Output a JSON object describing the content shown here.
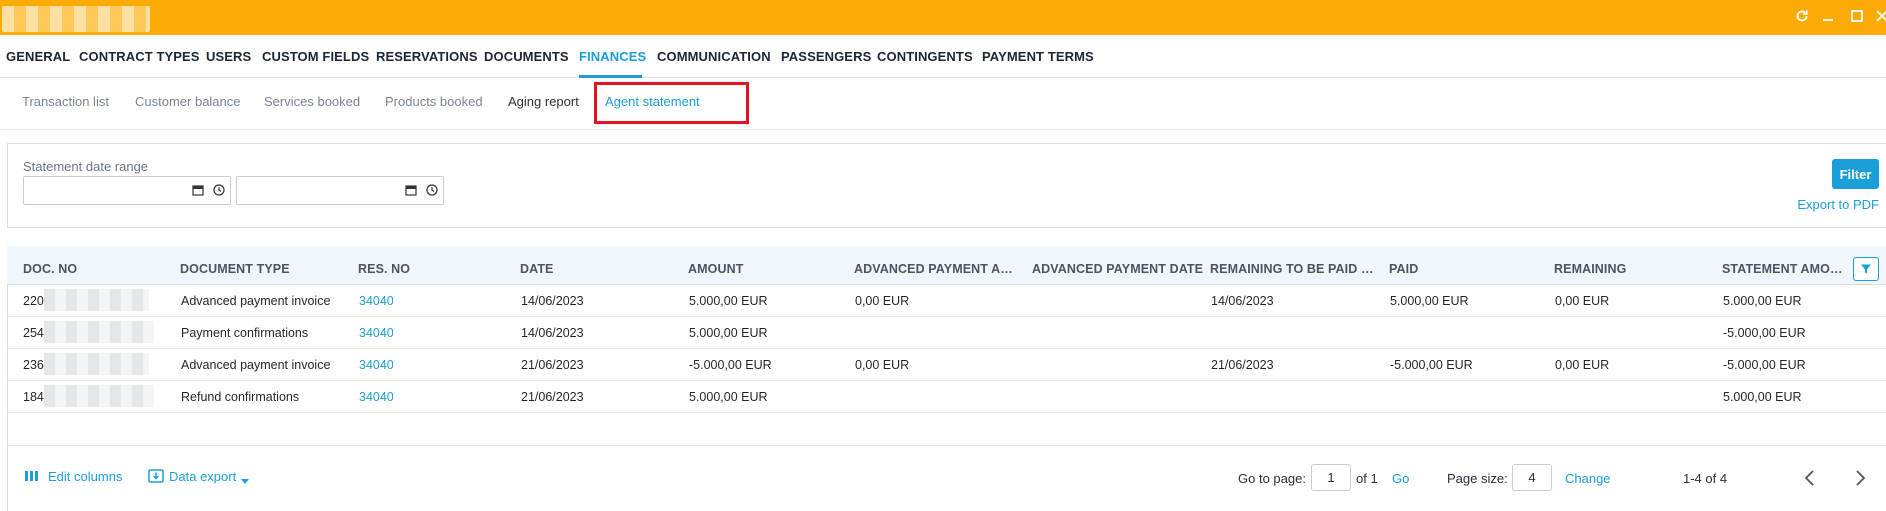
{
  "window": {
    "controls": [
      "refresh-icon",
      "minimize-icon",
      "maximize-icon",
      "close-icon"
    ]
  },
  "main_nav": {
    "tabs": [
      {
        "label": "GENERAL"
      },
      {
        "label": "CONTRACT TYPES"
      },
      {
        "label": "USERS"
      },
      {
        "label": "CUSTOM FIELDS"
      },
      {
        "label": "RESERVATIONS"
      },
      {
        "label": "DOCUMENTS"
      },
      {
        "label": "FINANCES",
        "active": true
      },
      {
        "label": "COMMUNICATION"
      },
      {
        "label": "PASSENGERS"
      },
      {
        "label": "CONTINGENTS"
      },
      {
        "label": "PAYMENT TERMS"
      }
    ]
  },
  "sub_nav": {
    "tabs": [
      {
        "label": "Transaction list"
      },
      {
        "label": "Customer balance"
      },
      {
        "label": "Services booked"
      },
      {
        "label": "Products booked"
      },
      {
        "label": "Aging report"
      },
      {
        "label": "Agent statement",
        "active": true
      }
    ]
  },
  "filter": {
    "label": "Statement date range",
    "from_value": "",
    "to_value": "",
    "filter_button": "Filter",
    "export_link": "Export to PDF"
  },
  "table": {
    "headers": [
      "DOC. NO",
      "DOCUMENT TYPE",
      "RES. NO",
      "DATE",
      "AMOUNT",
      "ADVANCED PAYMENT AM...",
      "ADVANCED PAYMENT DATE",
      "REMAINING TO BE PAID TI...",
      "PAID",
      "REMAINING",
      "STATEMENT AMOU..."
    ],
    "rows": [
      {
        "doc_no": "220",
        "doc_type": "Advanced payment invoice",
        "res_no": "34040",
        "date": "14/06/2023",
        "amount": "5.000,00 EUR",
        "adv_amount": "0,00 EUR",
        "adv_date": "",
        "remaining_date": "14/06/2023",
        "paid": "5.000,00 EUR",
        "remaining": "0,00 EUR",
        "statement_amount": "5.000,00 EUR"
      },
      {
        "doc_no": "254",
        "doc_type": "Payment confirmations",
        "res_no": "34040",
        "date": "14/06/2023",
        "amount": "5.000,00 EUR",
        "adv_amount": "",
        "adv_date": "",
        "remaining_date": "",
        "paid": "",
        "remaining": "",
        "statement_amount": "-5.000,00 EUR"
      },
      {
        "doc_no": "236",
        "doc_type": "Advanced payment invoice",
        "res_no": "34040",
        "date": "21/06/2023",
        "amount": "-5.000,00 EUR",
        "adv_amount": "0,00 EUR",
        "adv_date": "",
        "remaining_date": "21/06/2023",
        "paid": "-5.000,00 EUR",
        "remaining": "0,00 EUR",
        "statement_amount": "-5.000,00 EUR"
      },
      {
        "doc_no": "184",
        "doc_type": "Refund confirmations",
        "res_no": "34040",
        "date": "21/06/2023",
        "amount": "5.000,00 EUR",
        "adv_amount": "",
        "adv_date": "",
        "remaining_date": "",
        "paid": "",
        "remaining": "",
        "statement_amount": "5.000,00 EUR"
      }
    ]
  },
  "footer": {
    "edit_columns": "Edit columns",
    "data_export": "Data export",
    "go_to_page_label": "Go to page:",
    "current_page": "1",
    "of_pages": "of 1",
    "go": "Go",
    "page_size_label": "Page size:",
    "page_size": "4",
    "change": "Change",
    "range": "1-4 of 4"
  },
  "colors": {
    "titlebar": "#fcab05",
    "accent": "#1a9fd8",
    "highlight": "#e0141c"
  }
}
